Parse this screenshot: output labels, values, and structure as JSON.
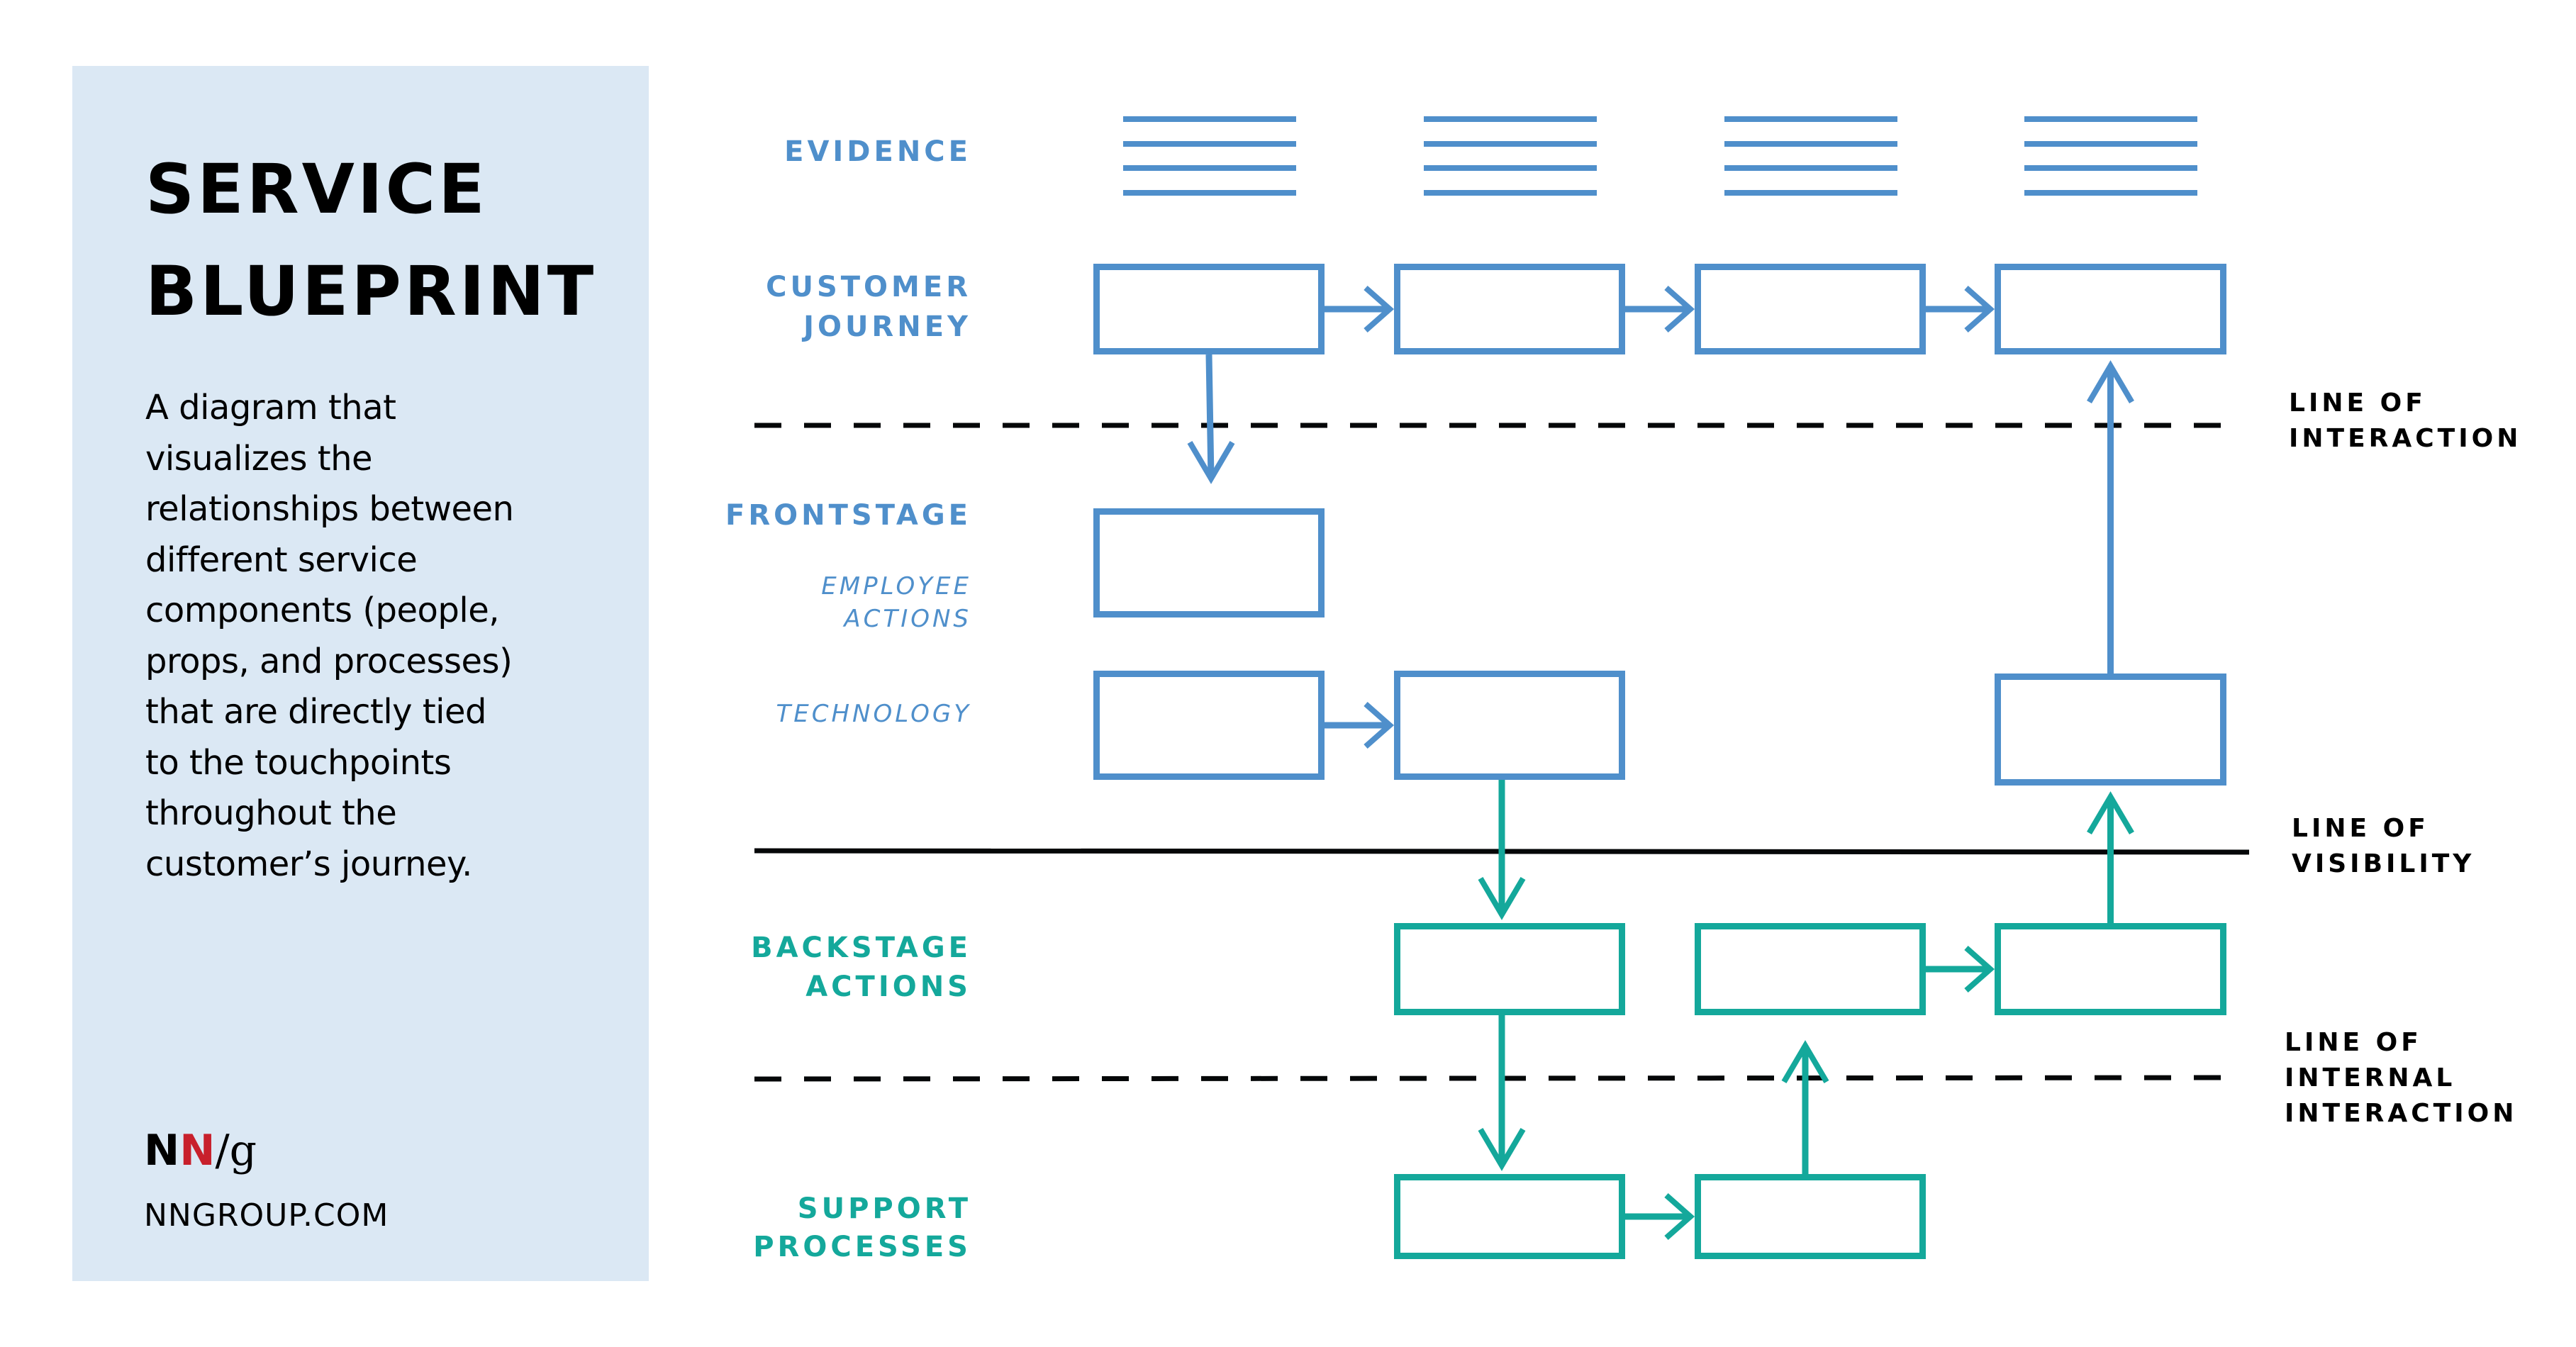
{
  "panel": {
    "title_lines": [
      "SERVICE",
      "BLUEPRINT"
    ],
    "description": "A diagram that visualizes the relationships between different service components (people, props, and processes) that are directly tied to the touchpoints throughout the customer’s journey.",
    "description_lines": [
      "A diagram that",
      "visualizes the",
      "relationships between",
      "different service",
      "components (people,",
      "props, and processes)",
      "that are directly tied",
      "to the touchpoints",
      "throughout the",
      "customer’s journey."
    ],
    "logo": {
      "n1": "N",
      "n2": "N",
      "slash": "/",
      "g": "g"
    },
    "url": "NNGROUP.COM"
  },
  "colors": {
    "panel_bg": "#DBE8F4",
    "frontstage_blue": "#4F8FCB",
    "backstage_teal": "#14A89B",
    "line_black": "#050708",
    "logo_red": "#C8202C"
  },
  "diagram": {
    "row_labels": {
      "evidence": [
        "EVIDENCE"
      ],
      "customer_journey": [
        "CUSTOMER",
        "JOURNEY"
      ],
      "frontstage": [
        "FRONTSTAGE"
      ],
      "employee_actions": [
        "EMPLOYEE",
        "ACTIONS"
      ],
      "technology": [
        "TECHNOLOGY"
      ],
      "backstage_actions": [
        "BACKSTAGE",
        "ACTIONS"
      ],
      "support_processes": [
        "SUPPORT",
        "PROCESSES"
      ]
    },
    "line_labels": {
      "interaction": [
        "LINE OF",
        "INTERACTION"
      ],
      "visibility": [
        "LINE OF",
        "VISIBILITY"
      ],
      "internal_interaction": [
        "LINE OF",
        "INTERNAL",
        "INTERACTION"
      ]
    },
    "columns": 4,
    "evidence_columns": [
      1,
      2,
      3,
      4
    ],
    "boxes": {
      "customer_journey": [
        1,
        2,
        3,
        4
      ],
      "employee_actions": [
        1
      ],
      "technology": [
        1,
        2,
        4
      ],
      "backstage_actions": [
        2,
        3,
        4
      ],
      "support_processes": [
        2,
        3
      ]
    },
    "connections": [
      {
        "from": "customer_journey.1",
        "to": "customer_journey.2",
        "color": "blue"
      },
      {
        "from": "customer_journey.2",
        "to": "customer_journey.3",
        "color": "blue"
      },
      {
        "from": "customer_journey.3",
        "to": "customer_journey.4",
        "color": "blue"
      },
      {
        "from": "customer_journey.1",
        "to": "employee_actions.1",
        "color": "blue"
      },
      {
        "from": "technology.1",
        "to": "technology.2",
        "color": "blue"
      },
      {
        "from": "technology.4",
        "to": "customer_journey.4",
        "color": "blue"
      },
      {
        "from": "technology.2",
        "to": "backstage_actions.2",
        "color": "teal"
      },
      {
        "from": "backstage_actions.3",
        "to": "backstage_actions.4",
        "color": "teal"
      },
      {
        "from": "backstage_actions.4",
        "to": "technology.4",
        "color": "teal"
      },
      {
        "from": "backstage_actions.2",
        "to": "support_processes.2",
        "color": "teal"
      },
      {
        "from": "support_processes.2",
        "to": "support_processes.3",
        "color": "teal"
      },
      {
        "from": "support_processes.3",
        "to": "backstage_actions.3",
        "color": "teal"
      }
    ]
  }
}
